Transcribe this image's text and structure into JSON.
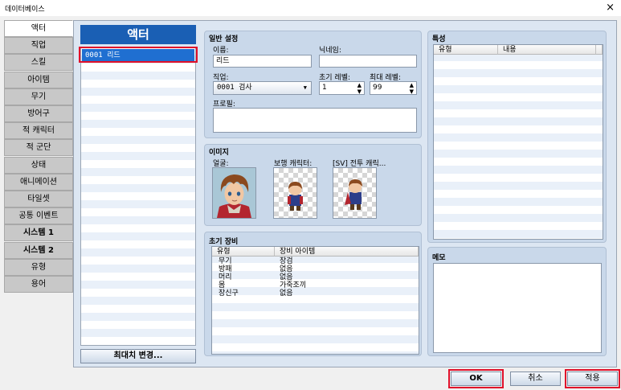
{
  "window": {
    "title": "데이터베이스",
    "close": "×"
  },
  "tabs": [
    {
      "label": "액터",
      "active": true,
      "bold": false
    },
    {
      "label": "직업",
      "bold": false
    },
    {
      "label": "스킬",
      "bold": false
    },
    {
      "label": "아이템",
      "bold": false
    },
    {
      "label": "무기",
      "bold": false
    },
    {
      "label": "방어구",
      "bold": false
    },
    {
      "label": "적 캐릭터",
      "bold": false
    },
    {
      "label": "적 군단",
      "bold": false
    },
    {
      "label": "상태",
      "bold": false
    },
    {
      "label": "애니메이션",
      "bold": false
    },
    {
      "label": "타일셋",
      "bold": false
    },
    {
      "label": "공통 이벤트",
      "bold": false
    },
    {
      "label": "시스템 1",
      "bold": true
    },
    {
      "label": "시스템 2",
      "bold": true
    },
    {
      "label": "유형",
      "bold": false
    },
    {
      "label": "용어",
      "bold": false
    }
  ],
  "actor_list": {
    "header": "액터",
    "items": [
      "0001 리드"
    ],
    "max_button": "최대치 변경..."
  },
  "general": {
    "title": "일반 설정",
    "name_label": "이름:",
    "name_value": "리드",
    "nickname_label": "닉네임:",
    "nickname_value": "",
    "class_label": "직업:",
    "class_value": "0001 검사",
    "init_level_label": "초기 레벨:",
    "init_level_value": "1",
    "max_level_label": "최대 레벨:",
    "max_level_value": "99",
    "profile_label": "프로필:",
    "profile_value": ""
  },
  "images": {
    "title": "이미지",
    "face_label": "얼굴:",
    "walk_label": "보행 캐릭터:",
    "sv_label": "[SV] 전투 캐릭..."
  },
  "equipment": {
    "title": "초기 장비",
    "headers": [
      "유형",
      "장비 아이템"
    ],
    "rows": [
      [
        "무기",
        "장검"
      ],
      [
        "방패",
        "없음"
      ],
      [
        "머리",
        "없음"
      ],
      [
        "몸",
        "가죽조끼"
      ],
      [
        "장신구",
        "없음"
      ]
    ]
  },
  "traits": {
    "title": "특성",
    "headers": [
      "유형",
      "내용"
    ]
  },
  "memo": {
    "title": "메모",
    "value": ""
  },
  "buttons": {
    "ok": "OK",
    "cancel": "취소",
    "apply": "적용"
  },
  "colors": {
    "accent": "#1a5fb4",
    "highlight": "#e0102a",
    "panel": "#c9d8ea"
  }
}
